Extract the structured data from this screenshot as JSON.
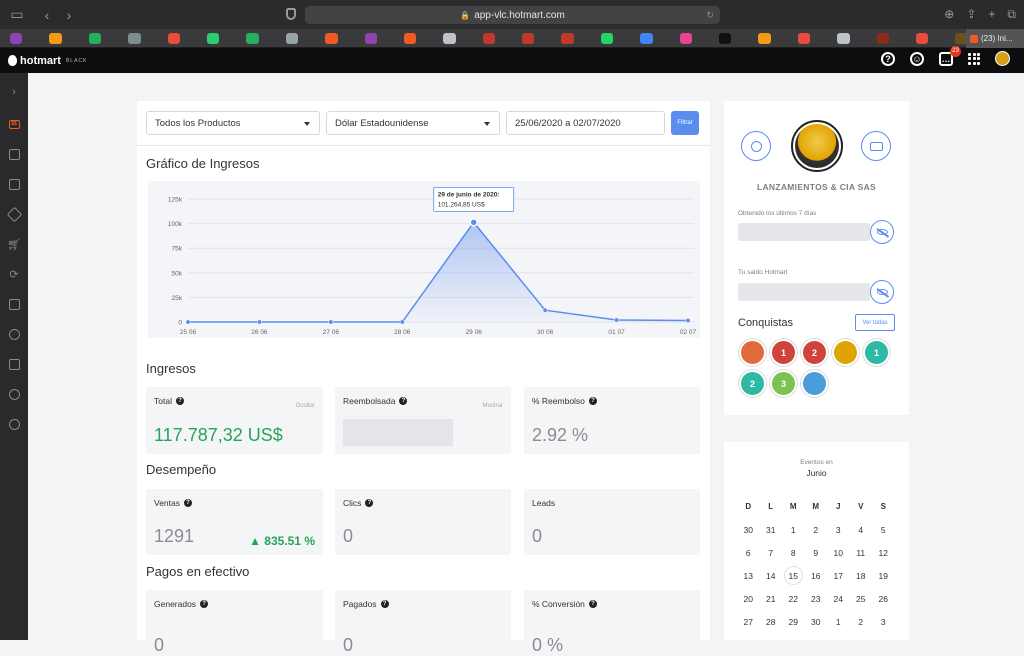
{
  "browser": {
    "url": "app-vlc.hotmart.com",
    "tab_title": "(23) Ini..."
  },
  "app": {
    "brand": "hotmart",
    "brand_tag": "BLACK",
    "chat_badge": "23"
  },
  "filters": {
    "product": "Todos los Productos",
    "currency": "Dólar Estadounidense",
    "date_range": "25/06/2020 a 02/07/2020",
    "filter_button": "Filtrar"
  },
  "chart_section_title": "Gráfico de Ingresos",
  "chart_data": {
    "type": "area",
    "categories": [
      "25 06",
      "26 06",
      "27 06",
      "28 06",
      "29 06",
      "30 06",
      "01 07",
      "02 07"
    ],
    "values": [
      0,
      0,
      0,
      0,
      101264.85,
      12000,
      2000,
      1500
    ],
    "y_ticks": [
      "0",
      "25k",
      "50k",
      "75k",
      "100k",
      "125k"
    ],
    "ylim": [
      0,
      125000
    ],
    "tooltip": {
      "title": "29 de junio de 2020:",
      "value": "101.264,85 US$",
      "index": 4
    },
    "line_color": "#5a8dee",
    "grid": true
  },
  "ingresos": {
    "title": "Ingresos",
    "total_label": "Total",
    "total_action": "Ocultar",
    "total_value": "117.787,32 US$",
    "reembolsada_label": "Reembolsada",
    "reembolsada_action": "Mostrar",
    "reembolso_label": "% Reembolso",
    "reembolso_value": "2.92 %"
  },
  "desempeno": {
    "title": "Desempeño",
    "ventas_label": "Ventas",
    "ventas_value": "1291",
    "ventas_growth": "835.51 %",
    "clics_label": "Clics",
    "clics_value": "0",
    "leads_label": "Leads",
    "leads_value": "0"
  },
  "pagos": {
    "title": "Pagos en efectivo",
    "generados_label": "Generados",
    "generados_value": "0",
    "pagados_label": "Pagados",
    "pagados_value": "0",
    "conversion_label": "% Conversión",
    "conversion_value": "0 %"
  },
  "profile": {
    "company": "LANZAMIENTOS & CIA SAS",
    "last7_label": "Obtenido los últimos 7 días",
    "balance_label": "Tu saldo Hotmart",
    "achievements_title": "Conquistas",
    "see_all": "Ver todas",
    "achievements": [
      {
        "num": "",
        "color": "#e06a3c"
      },
      {
        "num": "1",
        "color": "#d0433a"
      },
      {
        "num": "2",
        "color": "#d0433a"
      },
      {
        "num": "",
        "color": "#e0a400"
      },
      {
        "num": "1",
        "color": "#2fb8a6"
      },
      {
        "num": "2",
        "color": "#2fb8a6"
      },
      {
        "num": "3",
        "color": "#7cc152"
      },
      {
        "num": "",
        "color": "#4a9dd8"
      }
    ]
  },
  "calendar": {
    "subtitle": "Eventos en",
    "month": "Junio",
    "weekdays": [
      "D",
      "L",
      "M",
      "M",
      "J",
      "V",
      "S"
    ],
    "days": [
      [
        "30",
        "31",
        "1",
        "2",
        "3",
        "4",
        "5"
      ],
      [
        "6",
        "7",
        "8",
        "9",
        "10",
        "11",
        "12"
      ],
      [
        "13",
        "14",
        "15",
        "16",
        "17",
        "18",
        "19"
      ],
      [
        "20",
        "21",
        "22",
        "23",
        "24",
        "25",
        "26"
      ],
      [
        "27",
        "28",
        "29",
        "30",
        "1",
        "2",
        "3"
      ]
    ],
    "today": "15"
  }
}
